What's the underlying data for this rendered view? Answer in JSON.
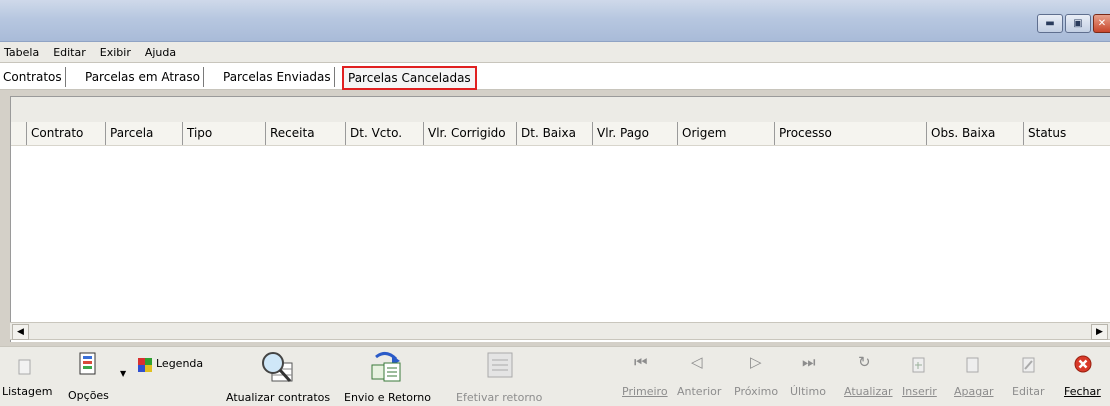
{
  "window": {
    "title": ""
  },
  "menu": [
    "Tabela",
    "Editar",
    "Exibir",
    "Ajuda"
  ],
  "tabs": [
    {
      "label": "Contratos",
      "active": false
    },
    {
      "label": "Parcelas em Atraso",
      "active": false
    },
    {
      "label": "Parcelas Enviadas",
      "active": false
    },
    {
      "label": "Parcelas Canceladas",
      "active": true
    }
  ],
  "grid": {
    "columns": [
      "Contrato",
      "Parcela",
      "Tipo",
      "Receita",
      "Dt. Vcto.",
      "Vlr. Corrigido",
      "Dt. Baixa",
      "Vlr. Pago",
      "Origem",
      "Processo",
      "Obs. Baixa",
      "Status"
    ],
    "rows": []
  },
  "toolbar": {
    "listagem": "Listagem",
    "opcoes": "Opções",
    "legenda": "Legenda",
    "atualizar_contratos": "Atualizar contratos",
    "envio_retorno": "Envio e Retorno",
    "efetivar_retorno": "Efetivar retorno",
    "primeiro": "Primeiro",
    "anterior": "Anterior",
    "proximo": "Próximo",
    "ultimo": "Último",
    "atualizar": "Atualizar",
    "inserir": "Inserir",
    "apagar": "Apagar",
    "editar": "Editar",
    "fechar": "Fechar"
  },
  "colors": {
    "highlight": "#e02020",
    "title_bar": "#b7c7e0"
  }
}
